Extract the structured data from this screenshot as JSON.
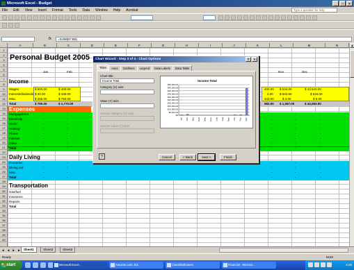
{
  "window": {
    "title": "Microsoft Excel - Budget",
    "buttons": [
      "_",
      "□",
      "×"
    ]
  },
  "menu": {
    "items": [
      "File",
      "Edit",
      "View",
      "Insert",
      "Format",
      "Tools",
      "Data",
      "Window",
      "Help",
      "Acrobat"
    ],
    "help_placeholder": "Type a question for help"
  },
  "formula_bar": {
    "name_box": "",
    "fx": "fx",
    "formula": "=SUM(B7:B9)"
  },
  "columns": [
    "A",
    "B",
    "C",
    "D",
    "E",
    "F",
    "G",
    "H",
    "I",
    "J",
    "K",
    "L",
    "M",
    "N"
  ],
  "rows": [
    "1",
    "2",
    "3",
    "4",
    "5",
    "6",
    "7",
    "8",
    "9",
    "10",
    "11",
    "12",
    "13",
    "14",
    "15",
    "16",
    "17",
    "18",
    "19",
    "20",
    "21",
    "22",
    "23",
    "24",
    "25",
    "26",
    "27",
    "28",
    "29",
    "30",
    "31",
    "32",
    "33",
    "34",
    "35",
    "36",
    "37",
    "38",
    "39",
    "40"
  ],
  "sheet": {
    "title": "Personal Budget 2005",
    "months": {
      "jan": "Jan",
      "feb": "Feb",
      "nov": "Nov",
      "dec": "Dec"
    },
    "income": {
      "header": "Income",
      "rows": [
        {
          "label": "Wages",
          "b": "$ 500.00",
          "c": "$ 400.00",
          "k": "400.00",
          "l": "$ 534.00",
          "m": "$ 43,543.00"
        },
        {
          "label": "Interest/dividends",
          "b": "$ 34.00",
          "c": "$ 435.00",
          "k": "4.00",
          "l": "$ 543.00",
          "m": "$ 534.00"
        },
        {
          "label": "Misc.",
          "b": "$ 256.00",
          "c": "$ 750.00",
          "k": "343.00",
          "l": "$ 3.00",
          "m": "$ 6.00"
        }
      ],
      "total": {
        "label": "Total",
        "b": "$ 790.00",
        "c": "$ 1,770.00",
        "k": "982.00",
        "l": "$ 1,067.00",
        "m": "$ 44,083.00"
      }
    },
    "expenses": {
      "header": "Expenses",
      "rows": [
        "Mortgage/rent",
        "Electricity",
        "Water",
        "Heating",
        "Phone",
        "Internet",
        "Other",
        "Total"
      ],
      "dash": "-"
    },
    "daily_living": {
      "header": "Daily Living",
      "rows": [
        "Groceries",
        "Dining out",
        "Misc.",
        "Total"
      ],
      "dash": "-"
    },
    "transportation": {
      "header": "Transportation",
      "rows": [
        "Gas/fuel",
        "Insurance",
        "Repairs",
        "Total"
      ]
    }
  },
  "dialog": {
    "title": "Chart Wizard - Step 3 of 4 - Chart Options",
    "buttons": [
      "?",
      "×"
    ],
    "tabs": [
      "Titles",
      "Axes",
      "Gridlines",
      "Legend",
      "Data Labels",
      "Data Table"
    ],
    "fields": {
      "chart_title_label": "Chart title:",
      "chart_title_value": "Income Total",
      "category_label": "Category (X) axis:",
      "value_label": "Value (Y) axis:",
      "second_category_label": "Second category (X) axis:",
      "second_value_label": "Second value (Y) axis:"
    },
    "footer": {
      "cancel": "Cancel",
      "back": "< Back",
      "next": "Next >",
      "finish": "Finish"
    }
  },
  "chart_data": {
    "type": "bar",
    "title": "Income Total",
    "categories": [
      "Jan",
      "Feb",
      "Mar",
      "April",
      "May",
      "June",
      "July",
      "Aug",
      "Sept",
      "Oct",
      "Nov",
      "Dec"
    ],
    "y_ticks": [
      "$50,000.00",
      "$45,000.00",
      "$40,000.00",
      "$35,000.00",
      "$30,000.00",
      "$25,000.00",
      "$20,000.00",
      "$15,000.00",
      "$10,000.00",
      "$5,000.00",
      "$0"
    ],
    "series": [
      {
        "values": [
          790,
          1770,
          0,
          0,
          0,
          0,
          0,
          0,
          0,
          982,
          1067,
          44083
        ]
      }
    ],
    "ylim": [
      0,
      50000
    ],
    "grid": true,
    "bar_color": "#7b7bd6"
  },
  "sheet_tabs": {
    "nav": "◄ ◄ ► ►",
    "tabs": [
      "Sheet1",
      "Sheet2",
      "Sheet3"
    ]
  },
  "status": {
    "left": "Ready",
    "right": "NUM"
  },
  "taskbar": {
    "start": "start",
    "items": [
      "Microsoft Excel...",
      "Amazon.com: Ed...",
      "Classifiedhomes",
      "Financial - Microso..."
    ],
    "clock": "4:25"
  },
  "colors": {
    "income_fill": "#ffff00",
    "expenses_fill": "#00e000",
    "daily_fill": "#00c8f0",
    "total_fill": "#c8c8c8",
    "expenses_header": "#ff6600"
  }
}
